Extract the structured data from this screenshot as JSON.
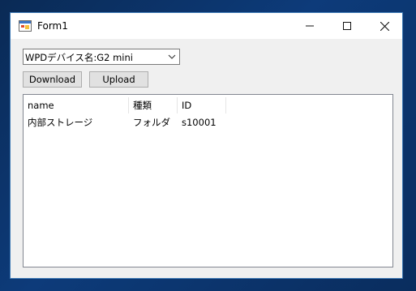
{
  "window": {
    "title": "Form1",
    "controls": {
      "minimize": "minimize-icon",
      "maximize": "maximize-icon",
      "close": "close-icon"
    }
  },
  "device_combo": {
    "selected": "WPDデバイス名:G2 mini"
  },
  "buttons": {
    "download": "Download",
    "upload": "Upload"
  },
  "list": {
    "columns": [
      "name",
      "種類",
      "ID"
    ],
    "rows": [
      {
        "name": "内部ストレージ",
        "type": "フォルダ",
        "id": "s10001"
      }
    ]
  }
}
